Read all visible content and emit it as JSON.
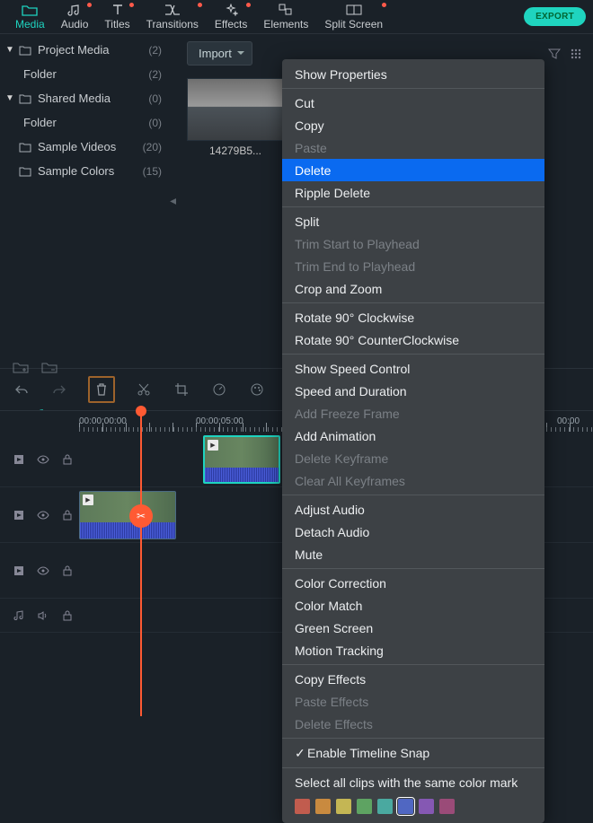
{
  "topbar": {
    "tabs": [
      {
        "label": "Media",
        "active": true
      },
      {
        "label": "Audio",
        "dot": true
      },
      {
        "label": "Titles",
        "dot": true
      },
      {
        "label": "Transitions",
        "dot": true
      },
      {
        "label": "Effects",
        "dot": true
      },
      {
        "label": "Elements"
      },
      {
        "label": "Split Screen",
        "dot": true
      }
    ],
    "export_label": "EXPORT"
  },
  "sidebar": {
    "items": [
      {
        "label": "Project Media",
        "count": "(2)",
        "folder": true,
        "arrow": true
      },
      {
        "label": "Folder",
        "count": "(2)",
        "indent": true
      },
      {
        "label": "Shared Media",
        "count": "(0)",
        "folder": true,
        "arrow": true
      },
      {
        "label": "Folder",
        "count": "(0)",
        "indent": true
      },
      {
        "label": "Sample Videos",
        "count": "(20)",
        "folder": true
      },
      {
        "label": "Sample Colors",
        "count": "(15)",
        "folder": true
      }
    ]
  },
  "content": {
    "import_label": "Import",
    "thumb_label": "14279B5..."
  },
  "timeline": {
    "timecodes": [
      "00:00:00:00",
      "00:00:05:00",
      "00:00"
    ]
  },
  "context_menu": {
    "groups": [
      [
        {
          "t": "Show Properties"
        }
      ],
      [
        {
          "t": "Cut"
        },
        {
          "t": "Copy"
        },
        {
          "t": "Paste",
          "d": true
        },
        {
          "t": "Delete",
          "hl": true
        },
        {
          "t": "Ripple Delete"
        }
      ],
      [
        {
          "t": "Split"
        },
        {
          "t": "Trim Start to Playhead",
          "d": true
        },
        {
          "t": "Trim End to Playhead",
          "d": true
        },
        {
          "t": "Crop and Zoom"
        }
      ],
      [
        {
          "t": "Rotate 90° Clockwise"
        },
        {
          "t": "Rotate 90° CounterClockwise"
        }
      ],
      [
        {
          "t": "Show Speed Control"
        },
        {
          "t": "Speed and Duration"
        },
        {
          "t": "Add Freeze Frame",
          "d": true
        },
        {
          "t": "Add Animation"
        },
        {
          "t": "Delete Keyframe",
          "d": true
        },
        {
          "t": "Clear All Keyframes",
          "d": true
        }
      ],
      [
        {
          "t": "Adjust Audio"
        },
        {
          "t": "Detach Audio"
        },
        {
          "t": "Mute"
        }
      ],
      [
        {
          "t": "Color Correction"
        },
        {
          "t": "Color Match"
        },
        {
          "t": "Green Screen"
        },
        {
          "t": "Motion Tracking"
        }
      ],
      [
        {
          "t": "Copy Effects"
        },
        {
          "t": "Paste Effects",
          "d": true
        },
        {
          "t": "Delete Effects",
          "d": true
        }
      ],
      [
        {
          "t": "Enable Timeline Snap",
          "c": true
        }
      ],
      [
        {
          "t": "Select all clips with the same color mark"
        }
      ]
    ],
    "colors": [
      "#c15c4e",
      "#c98a3f",
      "#c4b654",
      "#5ea362",
      "#4aa9a0",
      "#5067c2",
      "#8558b3",
      "#9a4b78"
    ],
    "selected_color_index": 5
  }
}
